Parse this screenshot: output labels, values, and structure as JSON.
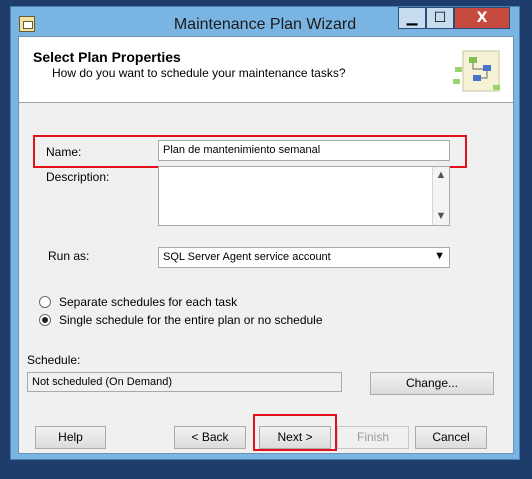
{
  "window": {
    "title": "Maintenance Plan Wizard",
    "controls": {
      "minimize": "▁",
      "maximize": "☐",
      "close": "X"
    }
  },
  "header": {
    "title": "Select Plan Properties",
    "subtitle": "How do you want to schedule your maintenance tasks?",
    "graphic_icon": "wizard-flowchart-icon"
  },
  "form": {
    "name_label": "Name:",
    "name_value": "Plan de mantenimiento semanal",
    "description_label": "Description:",
    "description_value": "",
    "runas_label": "Run as:",
    "runas_value": "SQL Server Agent service account"
  },
  "schedule_options": [
    {
      "label": "Separate schedules for each task",
      "checked": false
    },
    {
      "label": "Single schedule for the entire plan or no schedule",
      "checked": true
    }
  ],
  "schedule": {
    "label": "Schedule:",
    "value": "Not scheduled (On Demand)",
    "change_button": "Change..."
  },
  "buttons": {
    "help": "Help",
    "back": "< Back",
    "next": "Next >",
    "finish": "Finish",
    "cancel": "Cancel"
  },
  "colors": {
    "highlight": "#e0131b",
    "window_frame": "#7ab4e2",
    "close_button": "#c74a3f"
  }
}
